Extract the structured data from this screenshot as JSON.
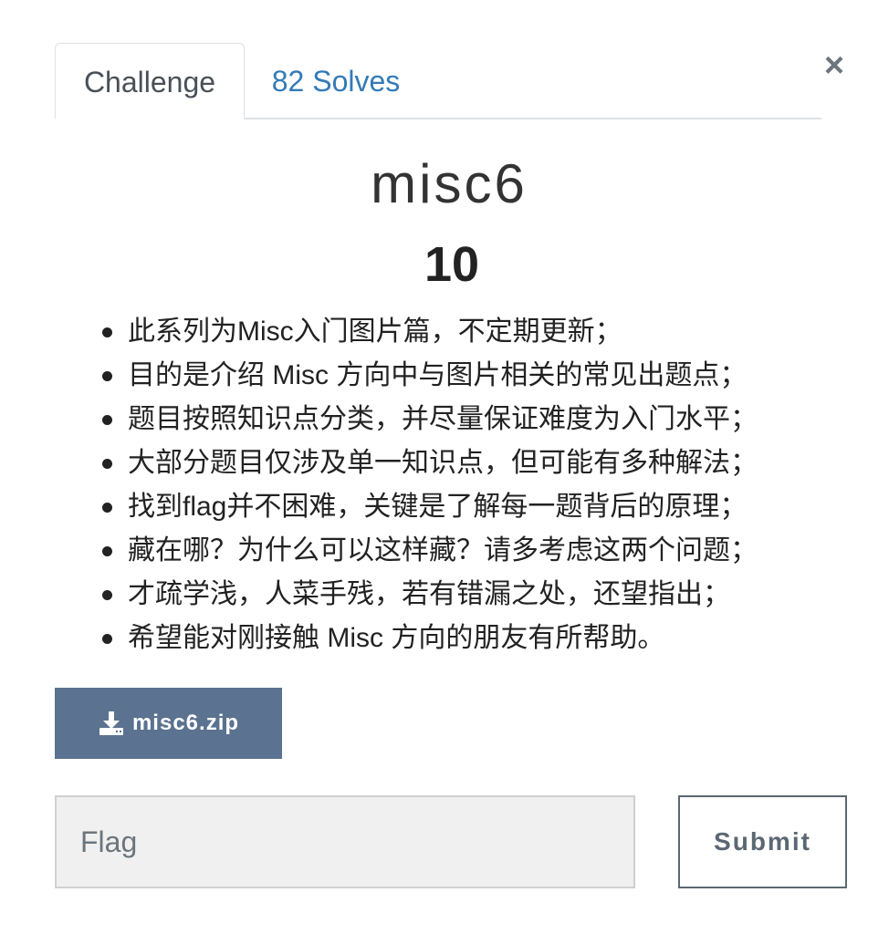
{
  "tabs": {
    "challenge_label": "Challenge",
    "solves_label": "82 Solves"
  },
  "close_icon": "×",
  "challenge": {
    "name": "misc6",
    "value": "10"
  },
  "description": [
    "此系列为Misc入门图片篇，不定期更新；",
    "目的是介绍 Misc 方向中与图片相关的常见出题点；",
    "题目按照知识点分类，并尽量保证难度为入门水平；",
    "大部分题目仅涉及单一知识点，但可能有多种解法；",
    "找到flag并不困难，关键是了解每一题背后的原理；",
    "藏在哪？为什么可以这样藏？请多考虑这两个问题；",
    "才疏学浅，人菜手残，若有错漏之处，还望指出；",
    "希望能对刚接触 Misc 方向的朋友有所帮助。"
  ],
  "file": {
    "icon": "download-icon",
    "label": "misc6.zip"
  },
  "flag_input": {
    "placeholder": "Flag",
    "value": ""
  },
  "submit_label": "Submit",
  "colors": {
    "file_button_bg": "#5b7290",
    "solves_link": "#337ab7",
    "submit_border": "#5b6773"
  }
}
